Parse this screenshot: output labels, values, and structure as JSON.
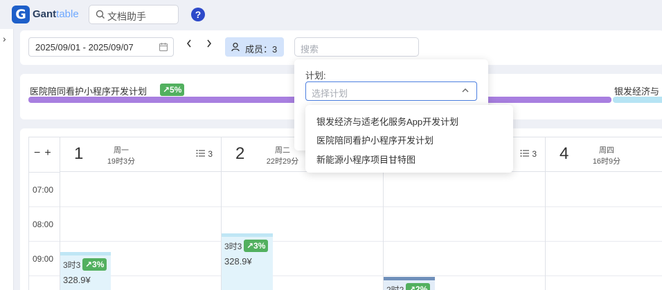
{
  "app": {
    "logo_letter": "G",
    "name_part1": "Gant",
    "name_part2": "table"
  },
  "doc_search": {
    "placeholder": "文档助手"
  },
  "help": {
    "label": "?"
  },
  "filter": {
    "date_range": "2025/09/01 - 2025/09/07",
    "members_label": "成员：3",
    "search_placeholder": "搜索"
  },
  "plans": [
    {
      "title": "医院陪同看护小程序开发计划",
      "progress": "↗5%",
      "color": "#a87fe0"
    },
    {
      "title": "银发经济与",
      "color": "#b6e4f4"
    }
  ],
  "calendar": {
    "zoom_out": "−",
    "zoom_in": "+",
    "days": [
      {
        "num": "1",
        "weekday": "周一",
        "hours": "19时3分",
        "count": "3"
      },
      {
        "num": "2",
        "weekday": "周二",
        "hours": "22时29分",
        "count": ""
      },
      {
        "num": "3",
        "weekday": "",
        "hours": "",
        "count": "3"
      },
      {
        "num": "4",
        "weekday": "周四",
        "hours": "16时9分",
        "count": ""
      }
    ],
    "times": [
      "07:00",
      "08:00",
      "09:00"
    ],
    "tasks": [
      {
        "duration": "3时3",
        "progress": "↗3%",
        "cost": "328.9¥"
      },
      {
        "duration": "3时3",
        "progress": "↗3%",
        "cost": "328.9¥"
      },
      {
        "duration": "2时2",
        "progress": "↗2%",
        "cost": ""
      }
    ]
  },
  "plan_filter": {
    "label": "计划:",
    "placeholder": "选择计划",
    "options": [
      "银发经济与适老化服务App开发计划",
      "医院陪同看护小程序开发计划",
      "新能源小程序项目甘特图"
    ]
  },
  "colors": {
    "accent": "#1e5fc9",
    "progress_badge": "#52b05f",
    "member_button": "#d3e3fb",
    "plan_bar_purple": "#a87fe0",
    "plan_bar_blue": "#b6e4f4"
  }
}
